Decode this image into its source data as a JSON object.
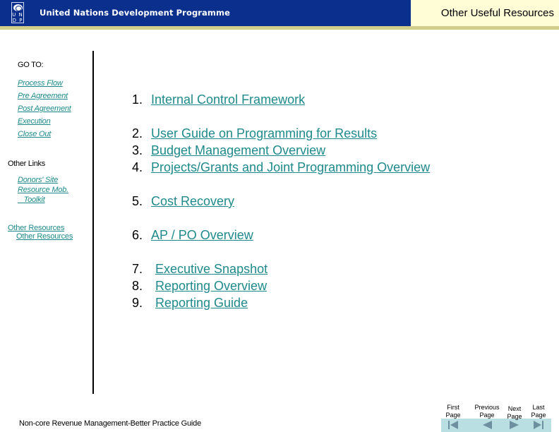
{
  "header": {
    "logo_letters": "U N\nD P",
    "org_name": "United Nations Development Programme",
    "section_title": "Other Useful Resources",
    "colors": {
      "header_bg": "#0a2f8c",
      "strip": "#d3cd8a",
      "section_box": "#fffdd6",
      "link": "#1f8a8a"
    }
  },
  "sidebar": {
    "goto_label": "GO TO:",
    "goto_links": [
      {
        "label": "Process Flow"
      },
      {
        "label": "Pre Agreement"
      },
      {
        "label": "Post Agreement"
      },
      {
        "label": "Execution"
      },
      {
        "label": "Close Out"
      }
    ],
    "other_links_label": "Other Links",
    "other_links": [
      {
        "label": "Donors' Site"
      },
      {
        "label": "Resource Mob."
      },
      {
        "label": "   Toolkit"
      }
    ],
    "other_resources": [
      {
        "label": "Other Resources"
      },
      {
        "label": "Other Resources"
      }
    ]
  },
  "main": {
    "items": [
      {
        "num": "1.",
        "label": "Internal Control Framework"
      },
      {
        "num": "2.",
        "label": "User Guide on Programming for Results"
      },
      {
        "num": "3.",
        "label": "Budget Management Overview"
      },
      {
        "num": "4.",
        "label": "Projects/Grants and Joint Programming Overview"
      },
      {
        "num": "5.",
        "label": "Cost Recovery"
      },
      {
        "num": "6.",
        "label": "AP / PO Overview"
      },
      {
        "num": "7.",
        "label": "Executive Snapshot"
      },
      {
        "num": "8.",
        "label": "Reporting Overview"
      },
      {
        "num": "9.",
        "label": "Reporting Guide"
      }
    ]
  },
  "footer": {
    "title": "Non-core Revenue Management-Better Practice Guide",
    "nav": [
      {
        "label": "First\nPage",
        "icon": "first-page-icon"
      },
      {
        "label": "Previous\nPage",
        "icon": "previous-page-icon"
      },
      {
        "label": "Next\nPage",
        "icon": "next-page-icon"
      },
      {
        "label": "Last\nPage",
        "icon": "last-page-icon"
      }
    ]
  }
}
